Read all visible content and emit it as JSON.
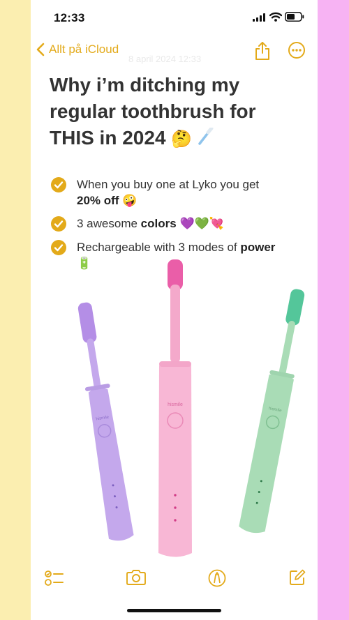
{
  "status_bar": {
    "time": "12:33"
  },
  "nav": {
    "back_label": "Allt på iCloud",
    "ghost_date": "8 april 2024 12:33"
  },
  "note": {
    "title_lines": [
      "Why i’m ditching my",
      "regular toothbrush for",
      "THIS in 2024"
    ],
    "title_emoji": "🤔",
    "items": [
      {
        "text": "When you buy one at Lyko you get ",
        "bold": "20% off",
        "emoji": "🤪"
      },
      {
        "text": "3 awesome ",
        "bold": "colors",
        "emoji": "💜💚💘"
      },
      {
        "text": "Rechargeable with 3 modes of ",
        "bold": "power",
        "emoji": "🔋"
      }
    ]
  },
  "product": {
    "brand_text": "hismile"
  },
  "colors": {
    "accent": "#e3aa1a",
    "left_bg": "#fbeeb0",
    "right_bg": "#f7b3f3",
    "purple": "#c4a8ec",
    "pink": "#f8b7d5",
    "green": "#a9dcb6"
  },
  "icons": [
    "back-chevron-icon",
    "share-icon",
    "more-icon",
    "checklist-icon",
    "camera-icon",
    "markup-icon",
    "compose-icon"
  ]
}
